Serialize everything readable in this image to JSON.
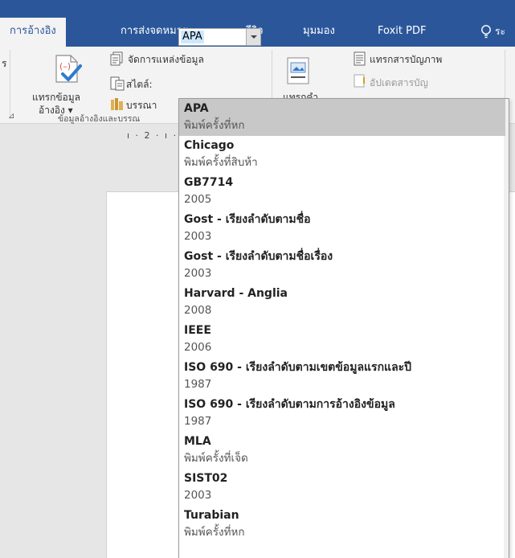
{
  "ribbon_tabs": [
    {
      "label": "การอ้างอิง",
      "active": true
    },
    {
      "label": "การส่งจดหมาย",
      "active": false
    },
    {
      "label": "รีวิว",
      "active": false
    },
    {
      "label": "มุมมอง",
      "active": false
    },
    {
      "label": "Foxit PDF",
      "active": false
    }
  ],
  "tell_me_cut": "ระ",
  "ribbon": {
    "cut_left_label": "ร",
    "insert_citation": {
      "line1": "แทรกข้อมูล",
      "line2": "อ้างอิง ▾"
    },
    "manage_sources": "จัดการแหล่งข้อมูล",
    "style_label": "สไตล์:",
    "style_value": "APA",
    "bibliography_cut": "บรรณา",
    "group_citations_cut": "ข้อมูลอ้างอิงและบรรณ",
    "insert_caption_cut": "แทรกคำ",
    "insert_table_of_figures": "แทรกสารบัญภาพ",
    "update_table_cut": "อัปเดตสารบัญ"
  },
  "ruler_text": "ı · 2 · ı ·",
  "style_options": [
    {
      "name": "APA",
      "edition": "พิมพ์ครั้งที่หก",
      "selected": true
    },
    {
      "name": "Chicago",
      "edition": "พิมพ์ครั้งที่สิบห้า",
      "selected": false
    },
    {
      "name": "GB7714",
      "edition": "2005",
      "selected": false
    },
    {
      "name": "Gost - เรียงลำดับตามชื่อ",
      "edition": "2003",
      "selected": false
    },
    {
      "name": "Gost - เรียงลำดับตามชื่อเรื่อง",
      "edition": "2003",
      "selected": false
    },
    {
      "name": "Harvard - Anglia",
      "edition": "2008",
      "selected": false
    },
    {
      "name": "IEEE",
      "edition": "2006",
      "selected": false
    },
    {
      "name": "ISO 690 - เรียงลำดับตามเขตข้อมูลแรกและปี",
      "edition": "1987",
      "selected": false
    },
    {
      "name": "ISO 690 - เรียงลำดับตามการอ้างอิงข้อมูล",
      "edition": "1987",
      "selected": false
    },
    {
      "name": "MLA",
      "edition": "พิมพ์ครั้งที่เจ็ด",
      "selected": false
    },
    {
      "name": "SIST02",
      "edition": "2003",
      "selected": false
    },
    {
      "name": "Turabian",
      "edition": "พิมพ์ครั้งที่หก",
      "selected": false
    }
  ],
  "colors": {
    "ribbon_blue": "#2b579a",
    "ribbon_body": "#f3f3f3",
    "selection_highlight": "#cce8ff",
    "list_selected": "#c8c8c8",
    "citation_icon_red": "#d9534f",
    "check_blue": "#2e7bcf"
  }
}
